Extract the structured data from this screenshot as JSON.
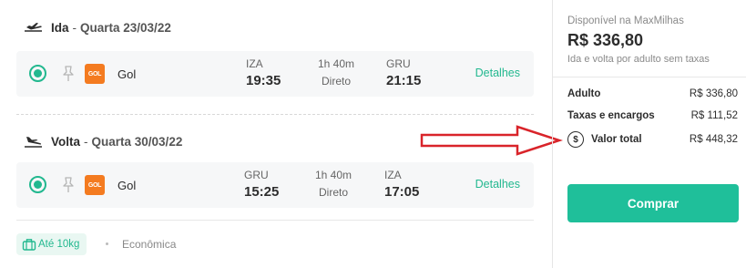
{
  "outbound": {
    "direction": "Ida",
    "separator": "-",
    "date": "Quarta 23/03/22",
    "airline": "Gol",
    "logo_text": "GOL",
    "origin_code": "IZA",
    "origin_time": "19:35",
    "duration": "1h 40m",
    "stops": "Direto",
    "dest_code": "GRU",
    "dest_time": "21:15",
    "details_label": "Detalhes"
  },
  "inbound": {
    "direction": "Volta",
    "separator": "-",
    "date": "Quarta 30/03/22",
    "airline": "Gol",
    "logo_text": "GOL",
    "origin_code": "GRU",
    "origin_time": "15:25",
    "duration": "1h 40m",
    "stops": "Direto",
    "dest_code": "IZA",
    "dest_time": "17:05",
    "details_label": "Detalhes"
  },
  "baggage": {
    "label": "Até 10kg",
    "cabin": "Econômica"
  },
  "summary": {
    "available_text": "Disponível na MaxMilhas",
    "price": "R$ 336,80",
    "price_note": "Ida e volta por adulto sem taxas",
    "rows": [
      {
        "label": "Adulto",
        "value": "R$ 336,80"
      },
      {
        "label": "Taxas e encargos",
        "value": "R$ 111,52"
      },
      {
        "label": "Valor total",
        "value": "R$ 448,32"
      }
    ],
    "total_icon_symbol": "$",
    "buy_label": "Comprar"
  },
  "colors": {
    "accent": "#22b88f",
    "button": "#1fbf9a",
    "airline": "#f47b20",
    "arrow": "#d9242a"
  }
}
